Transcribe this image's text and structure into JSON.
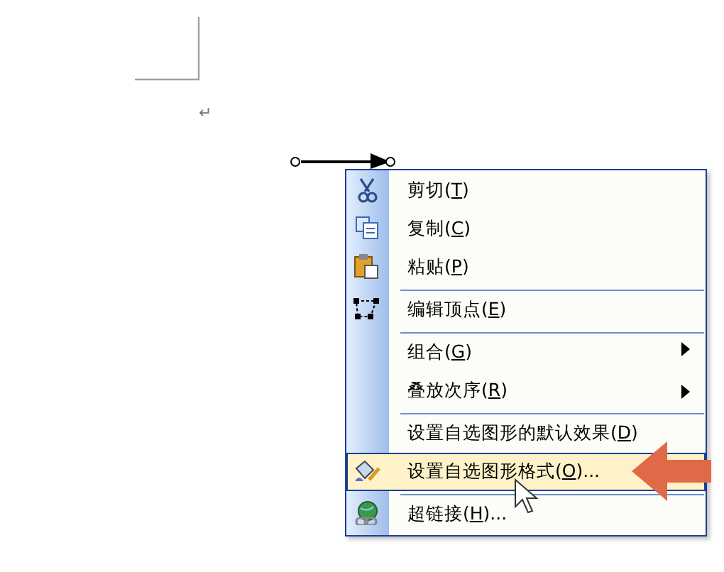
{
  "document": {
    "paragraph_mark": "↵"
  },
  "context_menu": {
    "items": [
      {
        "text": "剪切(",
        "key": "T",
        "tail": ")",
        "submenu": false,
        "selected": false,
        "separator_before": false
      },
      {
        "text": "复制(",
        "key": "C",
        "tail": ")",
        "submenu": false,
        "selected": false,
        "separator_before": false
      },
      {
        "text": "粘贴(",
        "key": "P",
        "tail": ")",
        "submenu": false,
        "selected": false,
        "separator_before": false
      },
      {
        "text": "编辑顶点(",
        "key": "E",
        "tail": ")",
        "submenu": false,
        "selected": false,
        "separator_before": true
      },
      {
        "text": "组合(",
        "key": "G",
        "tail": ")",
        "submenu": true,
        "selected": false,
        "separator_before": true
      },
      {
        "text": "叠放次序(",
        "key": "R",
        "tail": ")",
        "submenu": true,
        "selected": false,
        "separator_before": false
      },
      {
        "text": "设置自选图形的默认效果(",
        "key": "D",
        "tail": ")",
        "submenu": false,
        "selected": false,
        "separator_before": true
      },
      {
        "text": "设置自选图形格式(",
        "key": "O",
        "tail": ")...",
        "submenu": false,
        "selected": true,
        "separator_before": false
      },
      {
        "text": "超链接(",
        "key": "H",
        "tail": ")...",
        "submenu": false,
        "selected": false,
        "separator_before": true
      }
    ]
  }
}
